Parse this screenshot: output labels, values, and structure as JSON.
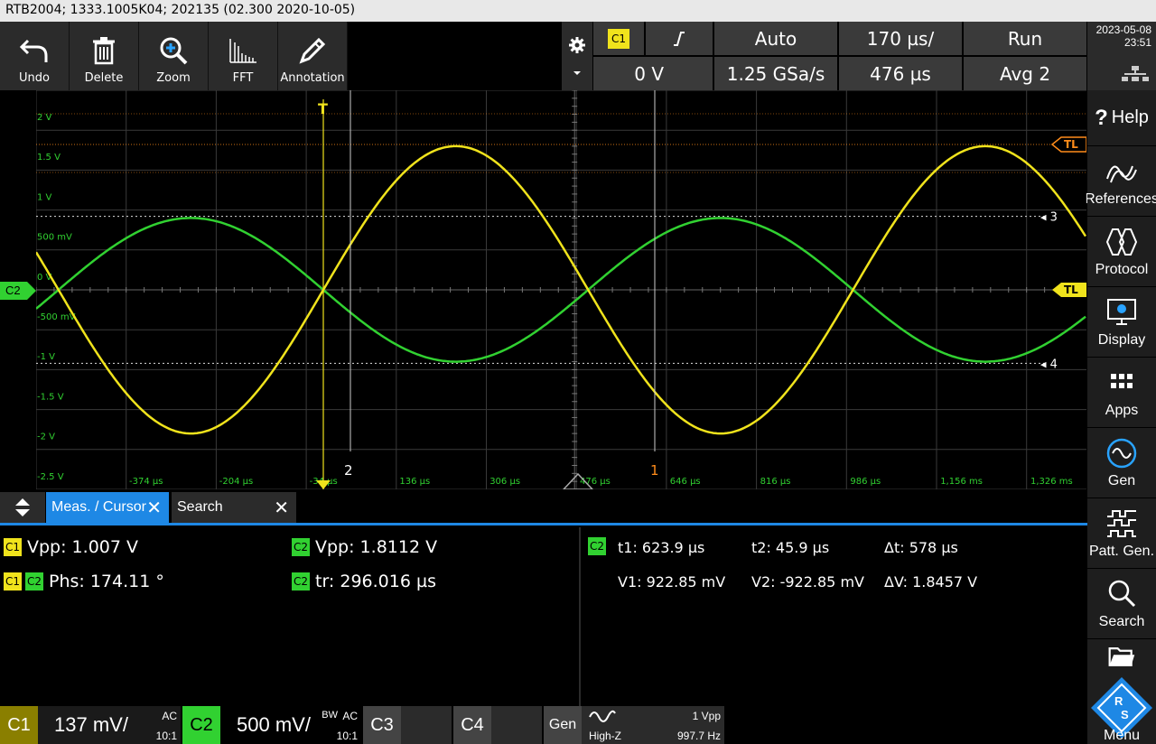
{
  "title_bar": "RTB2004; 1333.1005K04; 202135 (02.300 2020-10-05)",
  "toolbar": {
    "undo": "Undo",
    "delete": "Delete",
    "zoom": "Zoom",
    "fft": "FFT",
    "annotation": "Annotation"
  },
  "acquisition": {
    "trigger_source": "C1",
    "trigger_mode": "Auto",
    "timebase": "170 µs/",
    "run_state": "Run",
    "trigger_level": "0 V",
    "sample_rate": "1.25 GSa/s",
    "position": "476 µs",
    "averaging": "Avg 2"
  },
  "clock": {
    "date": "2023-05-08",
    "time": "23:51"
  },
  "side_menu": {
    "help": "Help",
    "references": "References",
    "protocol": "Protocol",
    "display": "Display",
    "apps": "Apps",
    "gen": "Gen",
    "patt_gen": "Patt. Gen.",
    "search": "Search",
    "menu": "Menu"
  },
  "screen": {
    "y_labels": [
      "2 V",
      "1.5 V",
      "1 V",
      "500 mV",
      "0 V",
      "-500 mV",
      "-1 V",
      "-1.5 V",
      "-2 V",
      "-2.5 V"
    ],
    "x_labels": [
      "-374 µs",
      "-204 µs",
      "-34 µs",
      "136 µs",
      "306 µs",
      "476 µs",
      "646 µs",
      "816 µs",
      "986 µs",
      "1,156 ms",
      "1,326 ms"
    ],
    "channel_marker": "C2",
    "trigger_level_label": "TL",
    "trigger_level_label2": "TL",
    "hcursor_top_label": "3",
    "hcursor_bottom_label": "4",
    "vcursor_left_label": "2",
    "vcursor_right_label": "1",
    "trigger_marker": "T"
  },
  "tabs": {
    "meas_cursor": "Meas. / Cursor",
    "search": "Search"
  },
  "measurements": {
    "c1_vpp": "Vpp: 1.007 V",
    "c2_vpp": "Vpp: 1.8112 V",
    "phase": "Phs: 174.11 °",
    "c2_tr": "tr: 296.016 µs"
  },
  "cursor": {
    "source": "C2",
    "t1": "t1: 623.9 µs",
    "t2": "t2: 45.9 µs",
    "dt": "Δt: 578 µs",
    "v1": "V1: 922.85 mV",
    "v2": "V2: -922.85 mV",
    "dv": "ΔV: 1.8457 V"
  },
  "channels": {
    "c1_name": "C1",
    "c1_scale": "137 mV/",
    "c1_coupling": "AC",
    "c1_probe": "10:1",
    "c2_name": "C2",
    "c2_scale": "500 mV/",
    "c2_coupling": "AC",
    "c2_bw": "BW",
    "c2_probe": "10:1",
    "c3_name": "C3",
    "c4_name": "C4",
    "gen_name": "Gen",
    "gen_load": "High-Z",
    "gen_amp": "1 Vpp",
    "gen_freq": "997.7 Hz"
  },
  "colors": {
    "c1": "#f0e31c",
    "c2": "#31d131",
    "grid": "#3a3a3a",
    "accent": "#1e88e5",
    "trigger": "#ff8c1a"
  },
  "signals": {
    "c1": {
      "amplitude_v": 1.8,
      "period_us": 1000,
      "phase_deg": 0
    },
    "c2": {
      "amplitude_v": 0.9,
      "period_us": 1000,
      "phase_deg": 174.11
    }
  }
}
